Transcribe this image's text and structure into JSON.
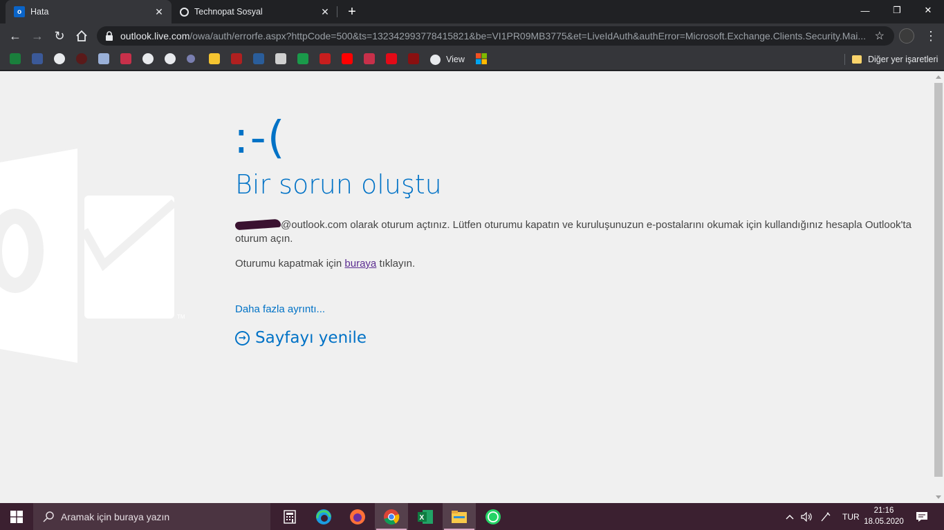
{
  "browser": {
    "tabs": [
      {
        "label": "Hata",
        "icon": "outlook-icon"
      },
      {
        "label": "Technopat Sosyal",
        "icon": "technopat-icon"
      }
    ],
    "url_host": "outlook.live.com",
    "url_path": "/owa/auth/errorfe.aspx?httpCode=500&ts=132342993778415821&be=VI1PR09MB3775&et=LiveIdAuth&authError=Microsoft.Exchange.Clients.Security.Mai...",
    "bookmarks": {
      "view_label": "View",
      "other_label": "Diğer yer işaretleri"
    }
  },
  "error_page": {
    "emoticon": ":-(",
    "heading": "Bir sorun oluştu",
    "message_suffix": "@outlook.com olarak oturum açtınız. Lütfen oturumu kapatın ve kuruluşunuzun e-postalarını okumak için kullandığınız hesapla Outlook'ta oturum açın.",
    "signout_prefix": "Oturumu kapatmak için ",
    "signout_link": "buraya",
    "signout_suffix": " tıklayın.",
    "more_details": "Daha fazla ayrıntı...",
    "refresh": "Sayfayı yenile"
  },
  "taskbar": {
    "search_placeholder": "Aramak için buraya yazın",
    "language": "TUR",
    "time": "21:16",
    "date": "18.05.2020"
  },
  "colors": {
    "accent": "#0072c6",
    "page_bg": "#f0f0f0",
    "taskbar": "#3b2030"
  }
}
